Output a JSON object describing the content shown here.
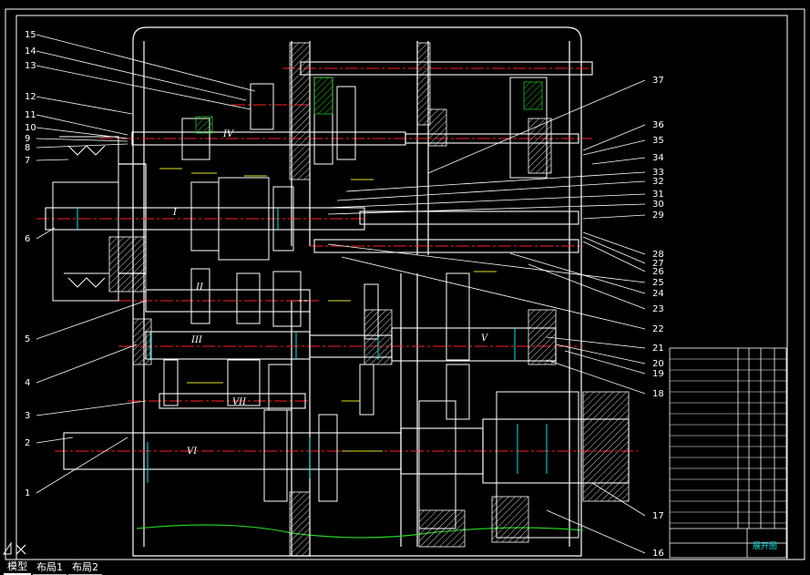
{
  "drawing": {
    "part_numbers_left": [
      "15",
      "14",
      "13",
      "12",
      "11",
      "10",
      "9",
      "8",
      "7",
      "6",
      "5",
      "4",
      "3",
      "2",
      "1"
    ],
    "part_numbers_right": [
      "37",
      "36",
      "35",
      "34",
      "33",
      "32",
      "31",
      "30",
      "29",
      "28",
      "27",
      "26",
      "25",
      "24",
      "23",
      "22",
      "21",
      "20",
      "19",
      "18",
      "17",
      "16"
    ],
    "shaft_labels": [
      "I",
      "II",
      "III",
      "IV",
      "V",
      "VI",
      "VII"
    ],
    "title_block_name": "展开图",
    "colors": {
      "background": "#000000",
      "outline": "#ffffff",
      "centerline": "#ff2020",
      "dimension": "#00e5e5",
      "hatch_green": "#20c020",
      "yellow": "#e0e020",
      "ground": "#22cc22"
    }
  },
  "tabs": [
    {
      "label": "模型",
      "active": true
    },
    {
      "label": "布局1",
      "active": false
    },
    {
      "label": "布局2",
      "active": false
    }
  ]
}
